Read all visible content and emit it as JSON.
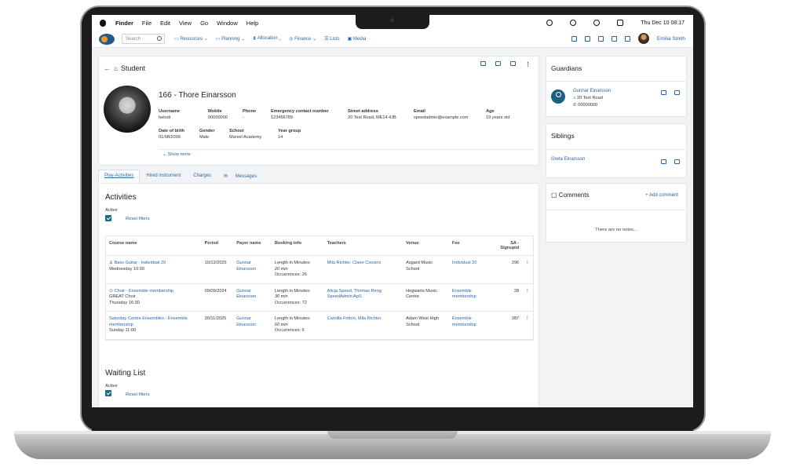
{
  "menubar": {
    "app": "Finder",
    "items": [
      "File",
      "Edit",
      "View",
      "Go",
      "Window",
      "Help"
    ],
    "clock": "Thu Dec 10  08:17"
  },
  "header": {
    "search_placeholder": "Search",
    "nav": [
      "Resources",
      "Planning",
      "Allocation",
      "Finance",
      "Lists",
      "Media"
    ],
    "user": "Emilia Smith"
  },
  "student": {
    "heading": "Student",
    "name": "166 - Thore Einarsson",
    "fields_row1": [
      {
        "label": "Username",
        "value": "helodi"
      },
      {
        "label": "Mobile",
        "value": "00000000"
      },
      {
        "label": "Phone",
        "value": "-"
      },
      {
        "label": "Emergency contact number",
        "value": "123456789"
      },
      {
        "label": "Street address",
        "value": "20 Test Road, ME14 4JB"
      },
      {
        "label": "Email",
        "value": "speedadmin@example.com"
      },
      {
        "label": "Age",
        "value": "19 years old"
      }
    ],
    "fields_row2": [
      {
        "label": "Date of birth",
        "value": "01/08/2006"
      },
      {
        "label": "Gender",
        "value": "Male"
      },
      {
        "label": "School",
        "value": "Marvel Academy"
      },
      {
        "label": "Year group",
        "value": "14"
      }
    ],
    "show_more": "Show more"
  },
  "tabs": [
    "Play-Activities",
    "Hired instrument",
    "Charges",
    "Messages"
  ],
  "activities": {
    "title": "Activities",
    "active_label": "Active",
    "reset": "Reset filters",
    "columns": [
      "Course name",
      "Period",
      "Payer name",
      "Booking info",
      "Teachers",
      "Venue",
      "Fee",
      "SA - Signupid"
    ],
    "rows": [
      {
        "course": "Bass Guitar - Individual 20",
        "sub1": "Wednesday 10:00",
        "sub2": "",
        "period": "10/12/2025",
        "payer": "Gunnar Einarsson",
        "booking1": "Length in Minutes:",
        "booking2": "20 min",
        "booking3": "Occurrences: 26",
        "teachers": "Mila Richter, Claire Cossins",
        "venue": "Asgard Music School",
        "fee": "Individual 20",
        "id": "296"
      },
      {
        "course": "Choir - Ensemble membership",
        "sub1": "GREAT Choir",
        "sub2": "Thursday 16:30",
        "period": "09/09/2024",
        "payer": "Gunnar Einarsson",
        "booking1": "Length in Minutes:",
        "booking2": "30 min",
        "booking3": "Occurrences: 72",
        "teachers": "Alicja Speed, Thomas Reng SpeedAdmin ApS",
        "venue": "Hogwarts Music Centre",
        "fee": "Ensemble membership",
        "id": "28"
      },
      {
        "course": "Saturday Centre Ensembles - Ensemble membership",
        "sub1": "Sunday 11:00",
        "sub2": "",
        "period": "30/11/2025",
        "payer": "Gunnar Einarsson",
        "booking1": "Length in Minutes:",
        "booking2": "60 min",
        "booking3": "Occurrences: 6",
        "teachers": "Camilla Fritton, Mila Richter",
        "venue": "Adam West High School",
        "fee": "Ensemble membership",
        "id": "287"
      }
    ]
  },
  "waiting": {
    "title": "Waiting List",
    "active_label": "Active",
    "reset": "Reset filters"
  },
  "guardians": {
    "title": "Guardians",
    "name": "Gunnar Einarsson",
    "address": "20 Test Road",
    "phone": "00000000"
  },
  "siblings": {
    "title": "Siblings",
    "name": "Greta Einarsson"
  },
  "comments": {
    "title": "Comments",
    "add": "+ Add comment",
    "empty": "There are no notes..."
  }
}
